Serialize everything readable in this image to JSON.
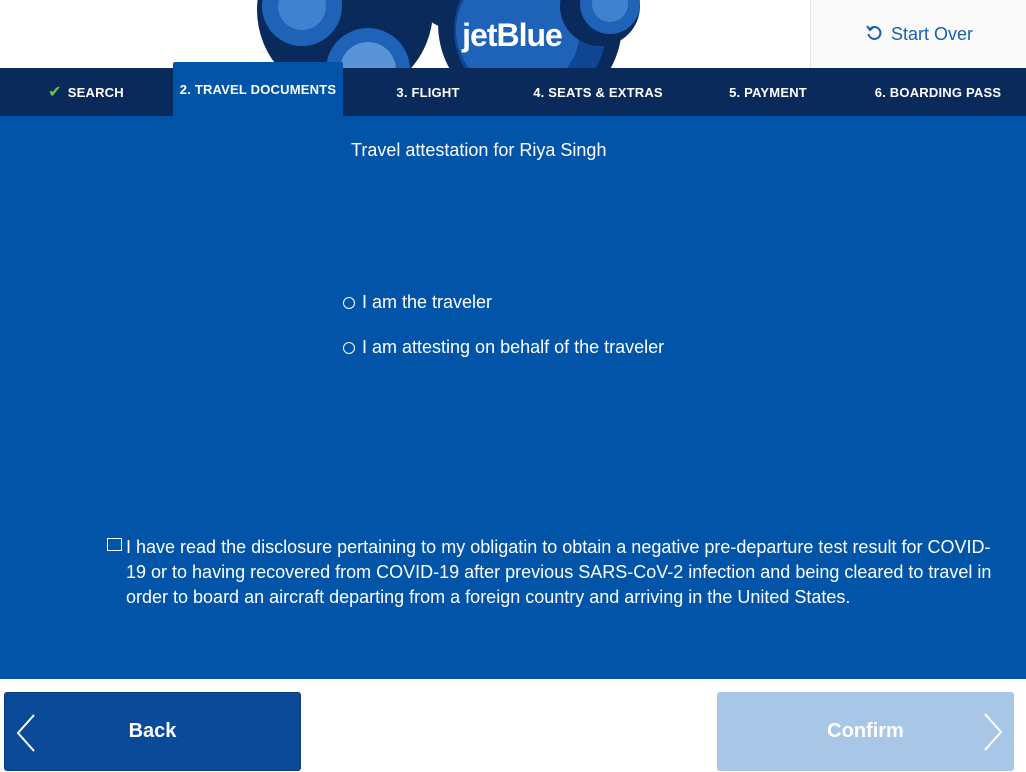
{
  "header": {
    "brand": "jetBlue",
    "start_over_label": "Start Over"
  },
  "nav": {
    "steps": [
      {
        "label": "SEARCH",
        "state": "complete"
      },
      {
        "label": "2. TRAVEL DOCUMENTS",
        "state": "active"
      },
      {
        "label": "3. FLIGHT",
        "state": "pending"
      },
      {
        "label": "4. SEATS & EXTRAS",
        "state": "pending"
      },
      {
        "label": "5. PAYMENT",
        "state": "pending"
      },
      {
        "label": "6. BOARDING PASS",
        "state": "pending"
      }
    ]
  },
  "main": {
    "title": "Travel attestation for Riya Singh",
    "options": [
      {
        "label": "I am the traveler",
        "selected": false
      },
      {
        "label": "I am attesting on behalf of the traveler",
        "selected": false
      }
    ],
    "disclosure": {
      "checked": false,
      "text": "I have read the disclosure pertaining to my obligatin to obtain a negative pre-departure test result for COVID-19 or to having recovered from COVID-19 after previous SARS-CoV-2 infection and being cleared to travel in order to board an aircraft departing from a foreign country and arriving in the United States."
    }
  },
  "footer": {
    "back_label": "Back",
    "confirm_label": "Confirm",
    "confirm_enabled": false
  },
  "colors": {
    "primary_blue": "#0154a7",
    "nav_navy": "#0b2a5c",
    "check_green": "#6cc04a",
    "confirm_disabled": "#a8c6e6"
  }
}
